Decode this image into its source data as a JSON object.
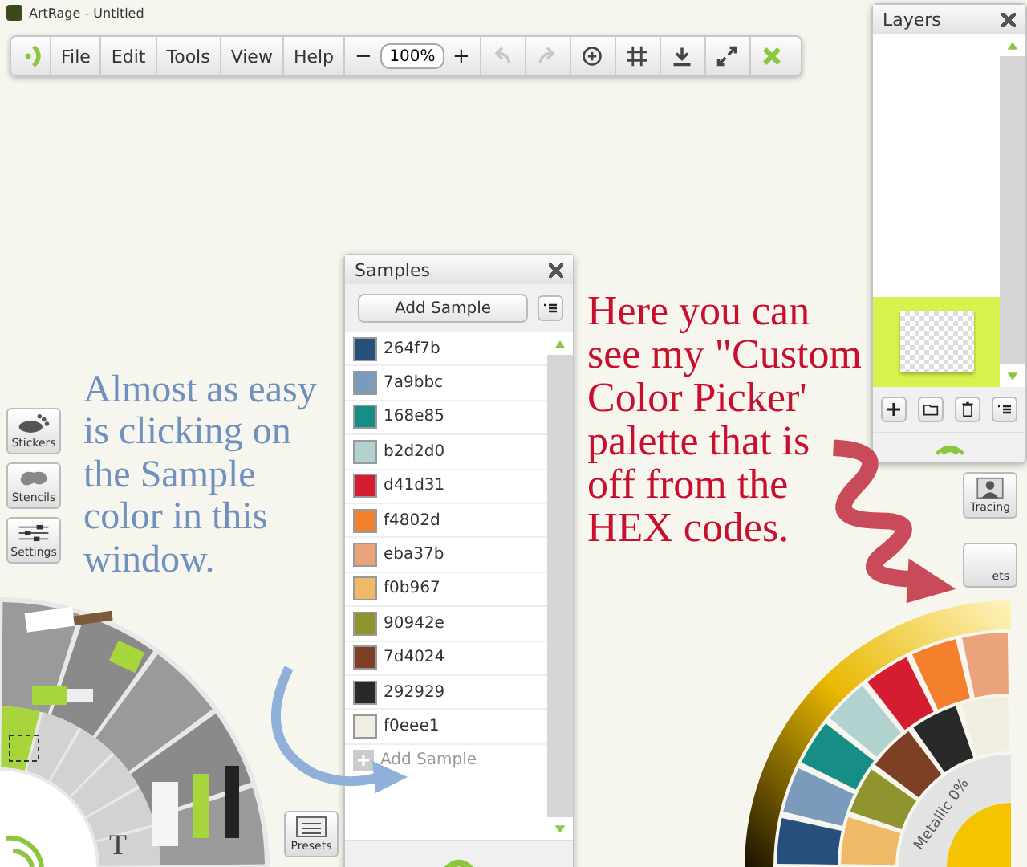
{
  "window": {
    "title": "ArtRage - Untitled"
  },
  "toolbar": {
    "menus": [
      "File",
      "Edit",
      "Tools",
      "View",
      "Help"
    ],
    "zoom_out": "−",
    "zoom": "100%",
    "zoom_in": "+",
    "actions": [
      {
        "kind": "undo",
        "disabled": true
      },
      {
        "kind": "redo",
        "disabled": true
      },
      {
        "kind": "rotate",
        "disabled": false
      },
      {
        "kind": "grid",
        "disabled": false
      },
      {
        "kind": "download",
        "disabled": false
      },
      {
        "kind": "expand",
        "disabled": false
      },
      {
        "kind": "close",
        "disabled": false
      }
    ]
  },
  "layers_panel": {
    "title": "Layers",
    "layers": [
      {
        "selected": true
      }
    ]
  },
  "right_buttons": [
    "Tracing",
    "ets"
  ],
  "left_buttons": [
    {
      "kind": "stickers",
      "label": "Stickers"
    },
    {
      "kind": "stencils",
      "label": "Stencils"
    },
    {
      "kind": "settings",
      "label": "Settings"
    }
  ],
  "samples_panel": {
    "title": "Samples",
    "add_button": "Add Sample",
    "samples": [
      {
        "label": "264f7b",
        "color": "#264f7b"
      },
      {
        "label": "7a9bbc",
        "color": "#7a9bbc"
      },
      {
        "label": "168e85",
        "color": "#168e85"
      },
      {
        "label": "b2d2d0",
        "color": "#b2d2d0"
      },
      {
        "label": "d41d31",
        "color": "#d41d31"
      },
      {
        "label": "f4802d",
        "color": "#f4802d"
      },
      {
        "label": "eba37b",
        "color": "#eba37b"
      },
      {
        "label": "f0b967",
        "color": "#f0b967"
      },
      {
        "label": "90942e",
        "color": "#90942e"
      },
      {
        "label": "7d4024",
        "color": "#7d4024"
      },
      {
        "label": "292929",
        "color": "#292929"
      },
      {
        "label": "f0eee1",
        "color": "#f0eee1"
      }
    ],
    "add_row": "Add Sample"
  },
  "tool_wheel": {
    "text_tool": "T"
  },
  "presets_button": "Presets",
  "color_picker": {
    "metallic": "Metallic 0%"
  },
  "annotations": [
    {
      "text": "Almost as easy is clicking on the Sample color in this window.",
      "color": "#7090bd"
    },
    {
      "text": "Here you can see my \"Custom Color Picker' palette that is off from the HEX codes.",
      "color": "#c8102e"
    }
  ]
}
